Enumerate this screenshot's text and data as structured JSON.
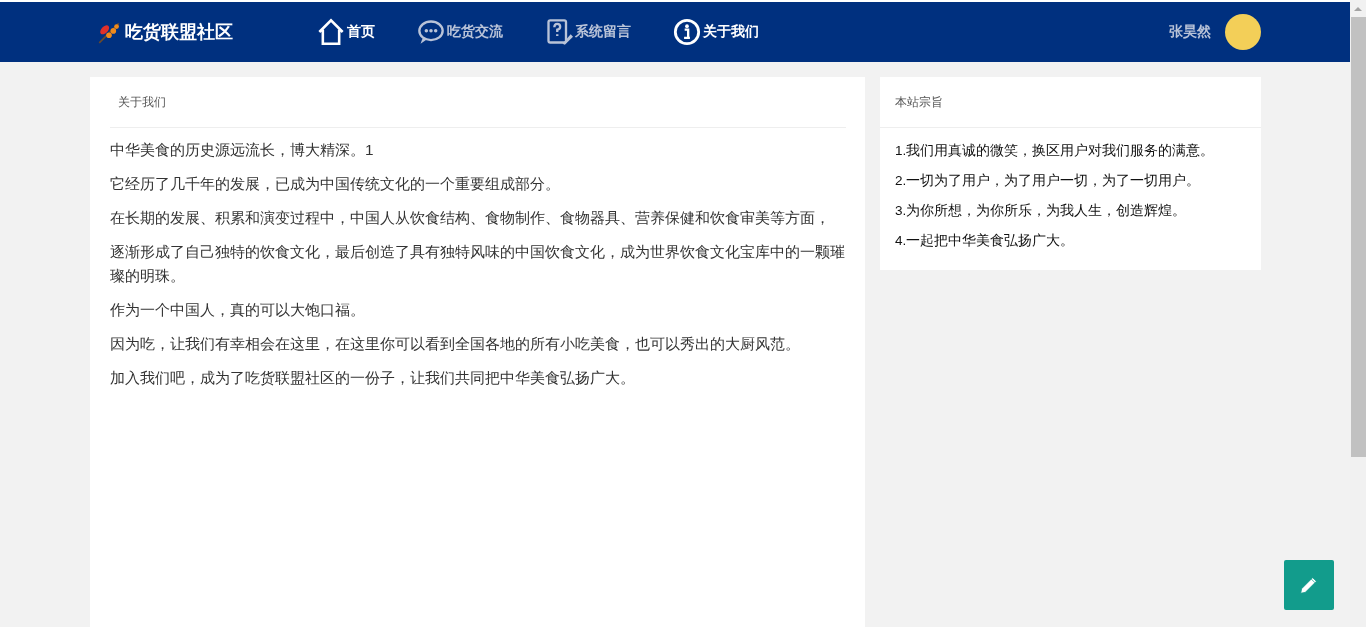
{
  "header": {
    "logo": "吃货联盟社区",
    "nav": [
      {
        "label": "首页",
        "selected": true
      },
      {
        "label": "吃货交流",
        "selected": false
      },
      {
        "label": "系统留言",
        "selected": false
      },
      {
        "label": "关于我们",
        "selected": true
      }
    ],
    "user": "张昊然"
  },
  "main": {
    "title": "关于我们",
    "paragraphs": [
      "中华美食的历史源远流长，博大精深。1",
      "它经历了几千年的发展，已成为中国传统文化的一个重要组成部分。",
      "在长期的发展、积累和演变过程中，中国人从饮食结构、食物制作、食物器具、营养保健和饮食审美等方面，",
      "逐渐形成了自己独特的饮食文化，最后创造了具有独特风味的中国饮食文化，成为世界饮食文化宝库中的一颗璀璨的明珠。",
      "作为一个中国人，真的可以大饱口福。",
      "因为吃，让我们有幸相会在这里，在这里你可以看到全国各地的所有小吃美食，也可以秀出的大厨风范。",
      "加入我们吧，成为了吃货联盟社区的一份子，让我们共同把中华美食弘扬广大。"
    ]
  },
  "side": {
    "title": "本站宗旨",
    "items": [
      "1.我们用真诚的微笑，换区用户对我们服务的满意。",
      "2.一切为了用户，为了用户一切，为了一切用户。",
      "3.为你所想，为你所乐，为我人生，创造辉煌。",
      "4.一起把中华美食弘扬广大。"
    ]
  }
}
